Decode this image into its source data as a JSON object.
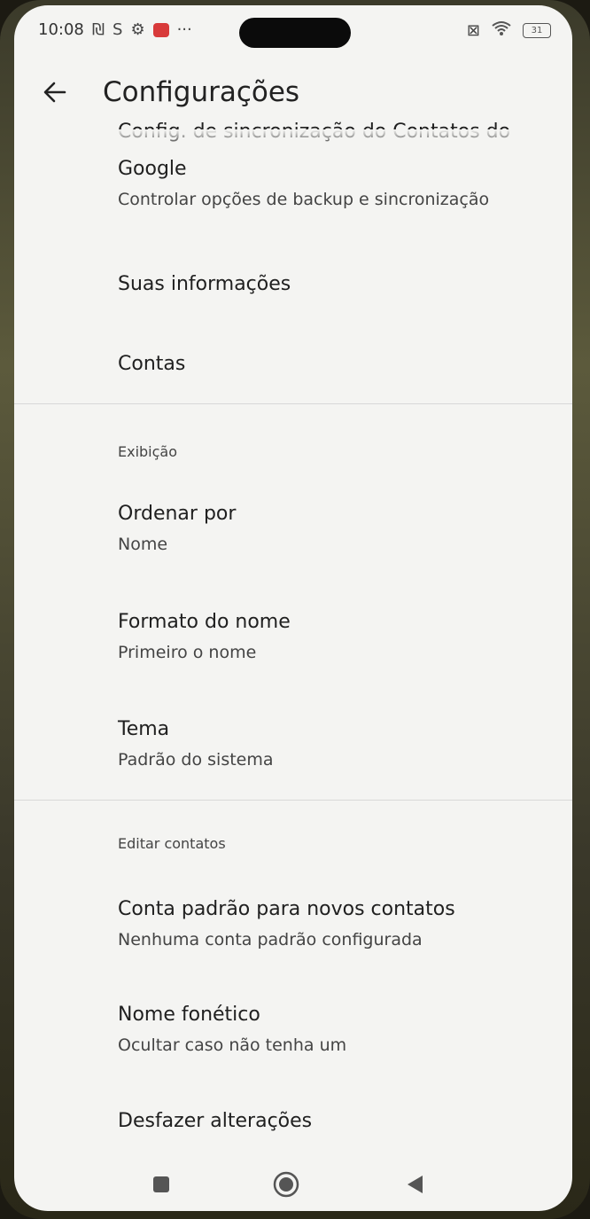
{
  "status_bar": {
    "time": "10:08",
    "icons": [
      "nfc-icon",
      "sim-icon",
      "gear-icon",
      "mail-icon",
      "more-icon",
      "no-signal-icon",
      "wifi-icon",
      "battery-icon"
    ],
    "battery_text": "31"
  },
  "app_bar": {
    "back_icon": "arrow-left-icon",
    "title": "Configurações"
  },
  "settings": {
    "sync": {
      "title_cut": "Config. de sincronização do Contatos do",
      "title_rest": "Google",
      "subtitle": "Controlar opções de backup e sincronização"
    },
    "your_info": {
      "title": "Suas informações"
    },
    "accounts": {
      "title": "Contas"
    },
    "display_section": {
      "header": "Exibição"
    },
    "sort_by": {
      "title": "Ordenar por",
      "subtitle": "Nome"
    },
    "name_format": {
      "title": "Formato do nome",
      "subtitle": "Primeiro o nome"
    },
    "theme": {
      "title": "Tema",
      "subtitle": "Padrão do sistema"
    },
    "edit_section": {
      "header": "Editar contatos"
    },
    "default_account": {
      "title": "Conta padrão para novos contatos",
      "subtitle": "Nenhuma conta padrão configurada"
    },
    "phonetic_name": {
      "title": "Nome fonético",
      "subtitle": "Ocultar caso não tenha um"
    },
    "undo_changes": {
      "title": "Desfazer alterações"
    }
  },
  "nav_bar": {
    "recents_icon": "square-icon",
    "home_icon": "circle-icon",
    "back_icon": "triangle-back-icon"
  },
  "colors": {
    "background": "#f4f4f2",
    "text_primary": "#202020",
    "text_secondary": "#444444",
    "divider": "#d8d8d8"
  }
}
